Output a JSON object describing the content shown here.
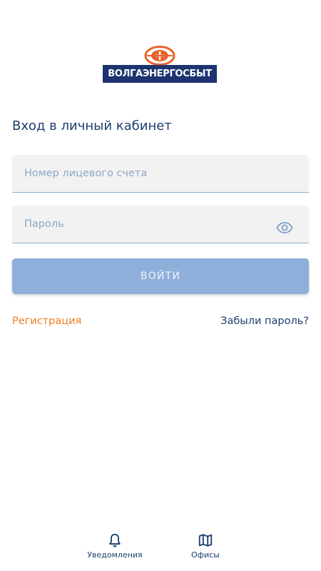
{
  "logo": {
    "text": "ВОЛГАЭНЕРГОСБЫТ"
  },
  "login": {
    "title": "Вход в личный кабинет",
    "account_placeholder": "Номер лицевого счета",
    "password_placeholder": "Пароль",
    "submit_label": "ВОЙТИ",
    "register_label": "Регистрация",
    "forgot_label": "Забыли пароль?"
  },
  "bottom_nav": {
    "items": [
      {
        "label": "Уведомления",
        "icon": "bell-icon"
      },
      {
        "label": "Офисы",
        "icon": "map-icon"
      }
    ]
  },
  "colors": {
    "brand_navy": "#1d3470",
    "title_text": "#1d3f6e",
    "accent_orange": "#ee7d21",
    "button_fill": "#8eafda",
    "field_fill": "#f2f2f2",
    "field_underline": "#8caed7"
  }
}
